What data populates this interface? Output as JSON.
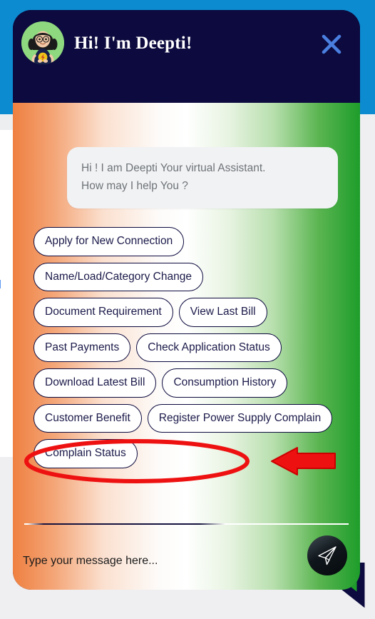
{
  "window": {
    "background_color": "#efeff1",
    "top_band_color": "#0d8bd1",
    "page_link_fragment": "al"
  },
  "widget": {
    "header": {
      "title": "Hi! I'm Deepti!",
      "avatar_name": "deepti-avatar",
      "avatar_bg": "#8ed97f",
      "background_color": "#0c0a3e",
      "close_label": "×",
      "close_color": "#4a7fe0"
    },
    "theme": {
      "gradient_start": "#ef8041",
      "gradient_mid": "#ffffff",
      "gradient_end": "#1e9d2b",
      "chip_text_color": "#1b1a4a",
      "chip_border_color": "#0c0a3e"
    },
    "messages": [
      {
        "sender": "bot",
        "lines": [
          "Hi ! I am Deepti Your virtual Assistant.",
          "How may I help You ?"
        ]
      }
    ],
    "quick_replies": [
      "Apply for New Connection",
      "Name/Load/Category Change",
      "Document Requirement",
      "View Last Bill",
      "Past Payments",
      "Check Application Status",
      "Download Latest Bill",
      "Consumption History",
      "Customer Benefit",
      "Register Power Supply Complain",
      "Complain Status"
    ],
    "composer": {
      "placeholder": "Type your message here...",
      "value": "",
      "send_icon": "paper-plane-icon"
    }
  },
  "annotation": {
    "highlight_target": "Register Power Supply Complain",
    "color": "#ee1111",
    "shapes": [
      "ellipse-highlight",
      "left-pointing-arrow"
    ]
  }
}
